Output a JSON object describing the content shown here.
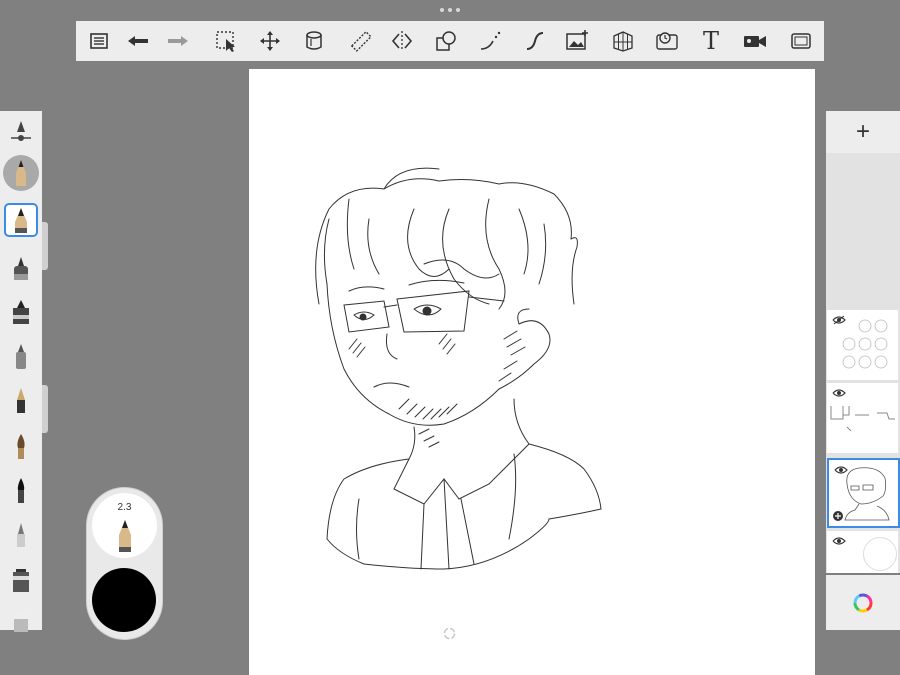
{
  "toolbar": {
    "tools": [
      {
        "name": "lagoon-menu-icon"
      },
      {
        "name": "undo-icon"
      },
      {
        "name": "redo-icon"
      },
      {
        "name": "selection-icon"
      },
      {
        "name": "transform-icon"
      },
      {
        "name": "fill-icon"
      },
      {
        "name": "ruler-icon"
      },
      {
        "name": "symmetry-icon"
      },
      {
        "name": "shapes-icon"
      },
      {
        "name": "predictive-stroke-icon"
      },
      {
        "name": "steady-stroke-icon"
      },
      {
        "name": "import-image-icon"
      },
      {
        "name": "perspective-guide-icon"
      },
      {
        "name": "time-lapse-icon"
      },
      {
        "name": "text-icon"
      },
      {
        "name": "record-icon"
      },
      {
        "name": "fullscreen-icon"
      }
    ],
    "text_tool_label": "T"
  },
  "brush_puck": {
    "size_value": "2.3",
    "color": "#000000"
  },
  "layers": {
    "add_label": "+",
    "items": [
      {
        "name": "layer-faces-sketch",
        "visible": true,
        "active": false
      },
      {
        "name": "layer-lines",
        "visible": true,
        "active": false
      },
      {
        "name": "layer-portrait",
        "visible": true,
        "active": true
      },
      {
        "name": "layer-background",
        "visible": true,
        "active": false
      }
    ]
  },
  "colors": {
    "accent": "#3c8ce6",
    "chrome": "#ededed",
    "backdrop": "#808080"
  }
}
